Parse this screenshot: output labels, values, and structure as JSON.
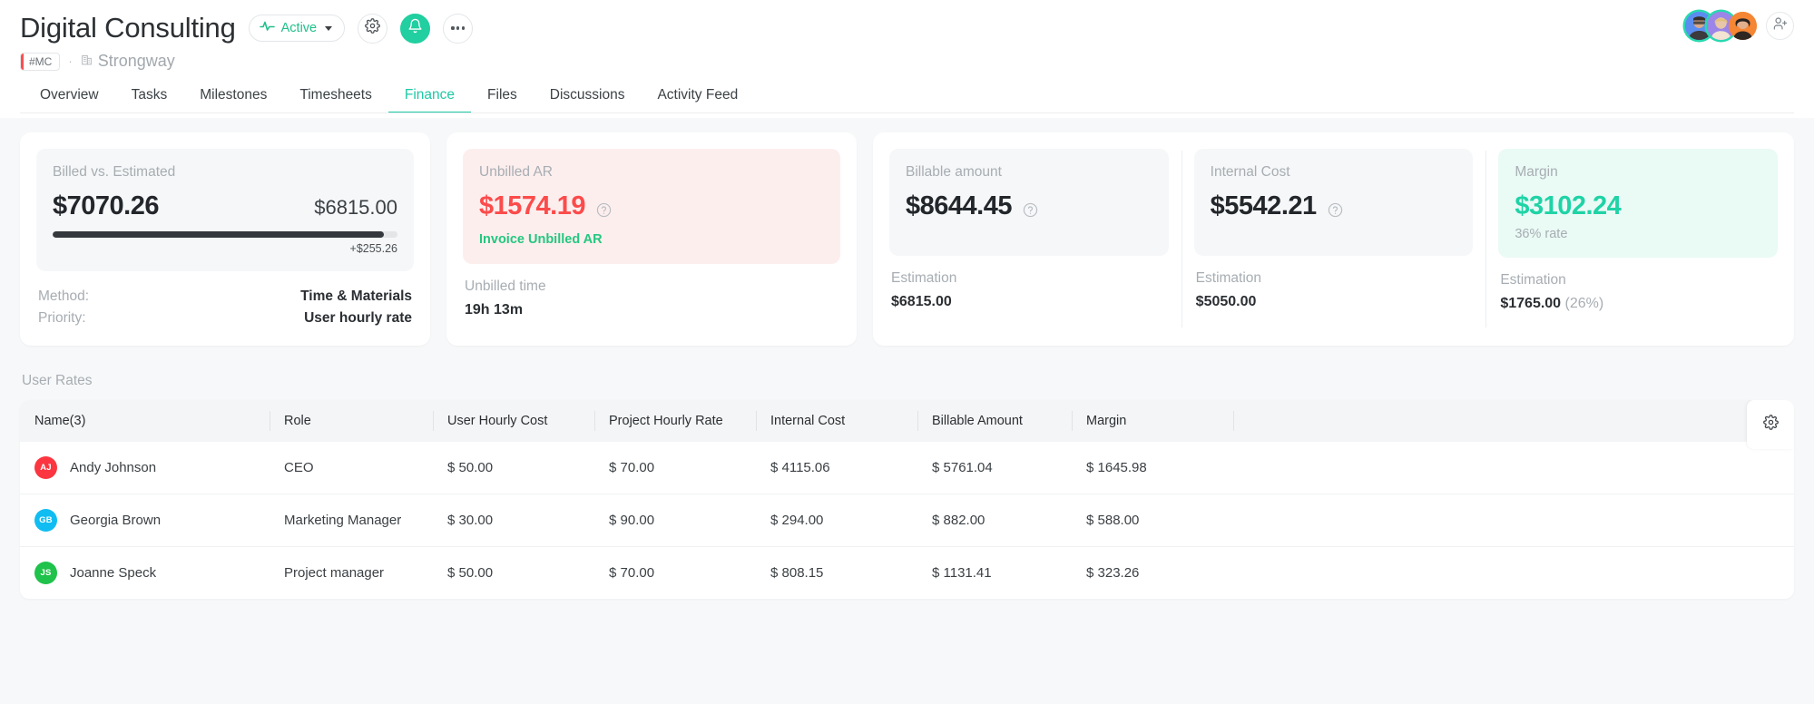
{
  "header": {
    "project_title": "Digital Consulting",
    "status": {
      "label": "Active",
      "icon": "pulse-icon",
      "color": "#21c08b"
    },
    "settings_icon": "gear-icon",
    "notifications_icon": "bell-icon",
    "more_icon": "ellipsis-icon",
    "code_badge": "#MC",
    "separator": "·",
    "company": "Strongway",
    "company_icon": "building-icon",
    "add_user_icon": "add-user-icon",
    "avatars": [
      {
        "name": "avatar-1",
        "ring": true,
        "ring_color": "#2ad8b0",
        "bg": "#5b8df0"
      },
      {
        "name": "avatar-2",
        "ring": true,
        "ring_color": "#2ad8b0",
        "bg": "#9b85e8"
      },
      {
        "name": "avatar-3",
        "ring": false,
        "ring_color": "",
        "bg": "#f58634"
      }
    ]
  },
  "tabs": [
    {
      "label": "Overview",
      "active": false
    },
    {
      "label": "Tasks",
      "active": false
    },
    {
      "label": "Milestones",
      "active": false
    },
    {
      "label": "Timesheets",
      "active": false
    },
    {
      "label": "Finance",
      "active": true
    },
    {
      "label": "Files",
      "active": false
    },
    {
      "label": "Discussions",
      "active": false
    },
    {
      "label": "Activity Feed",
      "active": false
    }
  ],
  "billed_card": {
    "label": "Billed vs. Estimated",
    "billed": "$7070.26",
    "estimated": "$6815.00",
    "progress_percent": 96,
    "over_amount": "+$255.26",
    "method_key": "Method:",
    "method_value": "Time & Materials",
    "priority_key": "Priority:",
    "priority_value": "User hourly rate"
  },
  "unbilled_card": {
    "label": "Unbilled AR",
    "amount": "$1574.19",
    "amount_color": "#fc4b4b",
    "help_icon": "help-circle-icon",
    "action_link": "Invoice Unbilled AR",
    "action_color": "#23c77f",
    "sub_label": "Unbilled time",
    "sub_value": "19h 13m"
  },
  "metrics": [
    {
      "label": "Billable amount",
      "value": "$8644.45",
      "value_color": "#23272b",
      "help_icon": "help-circle-icon",
      "has_help": true,
      "rate": "",
      "panel_style": "gray",
      "estimation_label": "Estimation",
      "estimation_value": "$6815.00",
      "estimation_extra": ""
    },
    {
      "label": "Internal Cost",
      "value": "$5542.21",
      "value_color": "#23272b",
      "help_icon": "help-circle-icon",
      "has_help": true,
      "rate": "",
      "panel_style": "gray",
      "estimation_label": "Estimation",
      "estimation_value": "$5050.00",
      "estimation_extra": ""
    },
    {
      "label": "Margin",
      "value": "$3102.24",
      "value_color": "#1fd3a6",
      "help_icon": "",
      "has_help": false,
      "rate": "36% rate",
      "panel_style": "mint",
      "estimation_label": "Estimation",
      "estimation_value": "$1765.00",
      "estimation_extra": "(26%)"
    }
  ],
  "user_rates": {
    "section_title": "User Rates",
    "settings_icon": "gear-icon",
    "columns": [
      "Name(3)",
      "Role",
      "User Hourly Cost",
      "Project Hourly Rate",
      "Internal Cost",
      "Billable Amount",
      "Margin",
      ""
    ],
    "rows": [
      {
        "initials": "AJ",
        "avatar_color": "#fb3640",
        "name": "Andy Johnson",
        "role": "CEO",
        "user_hourly_cost": "$ 50.00",
        "project_hourly_rate": "$ 70.00",
        "internal_cost": "$ 4115.06",
        "billable_amount": "$ 5761.04",
        "margin": "$ 1645.98"
      },
      {
        "initials": "GB",
        "avatar_color": "#10bdf2",
        "name": "Georgia Brown",
        "role": "Marketing Manager",
        "user_hourly_cost": "$ 30.00",
        "project_hourly_rate": "$ 90.00",
        "internal_cost": "$ 294.00",
        "billable_amount": "$ 882.00",
        "margin": "$ 588.00"
      },
      {
        "initials": "JS",
        "avatar_color": "#1fc24a",
        "name": "Joanne Speck",
        "role": "Project manager",
        "user_hourly_cost": "$ 50.00",
        "project_hourly_rate": "$ 70.00",
        "internal_cost": "$ 808.15",
        "billable_amount": "$ 1131.41",
        "margin": "$ 323.26"
      }
    ]
  }
}
